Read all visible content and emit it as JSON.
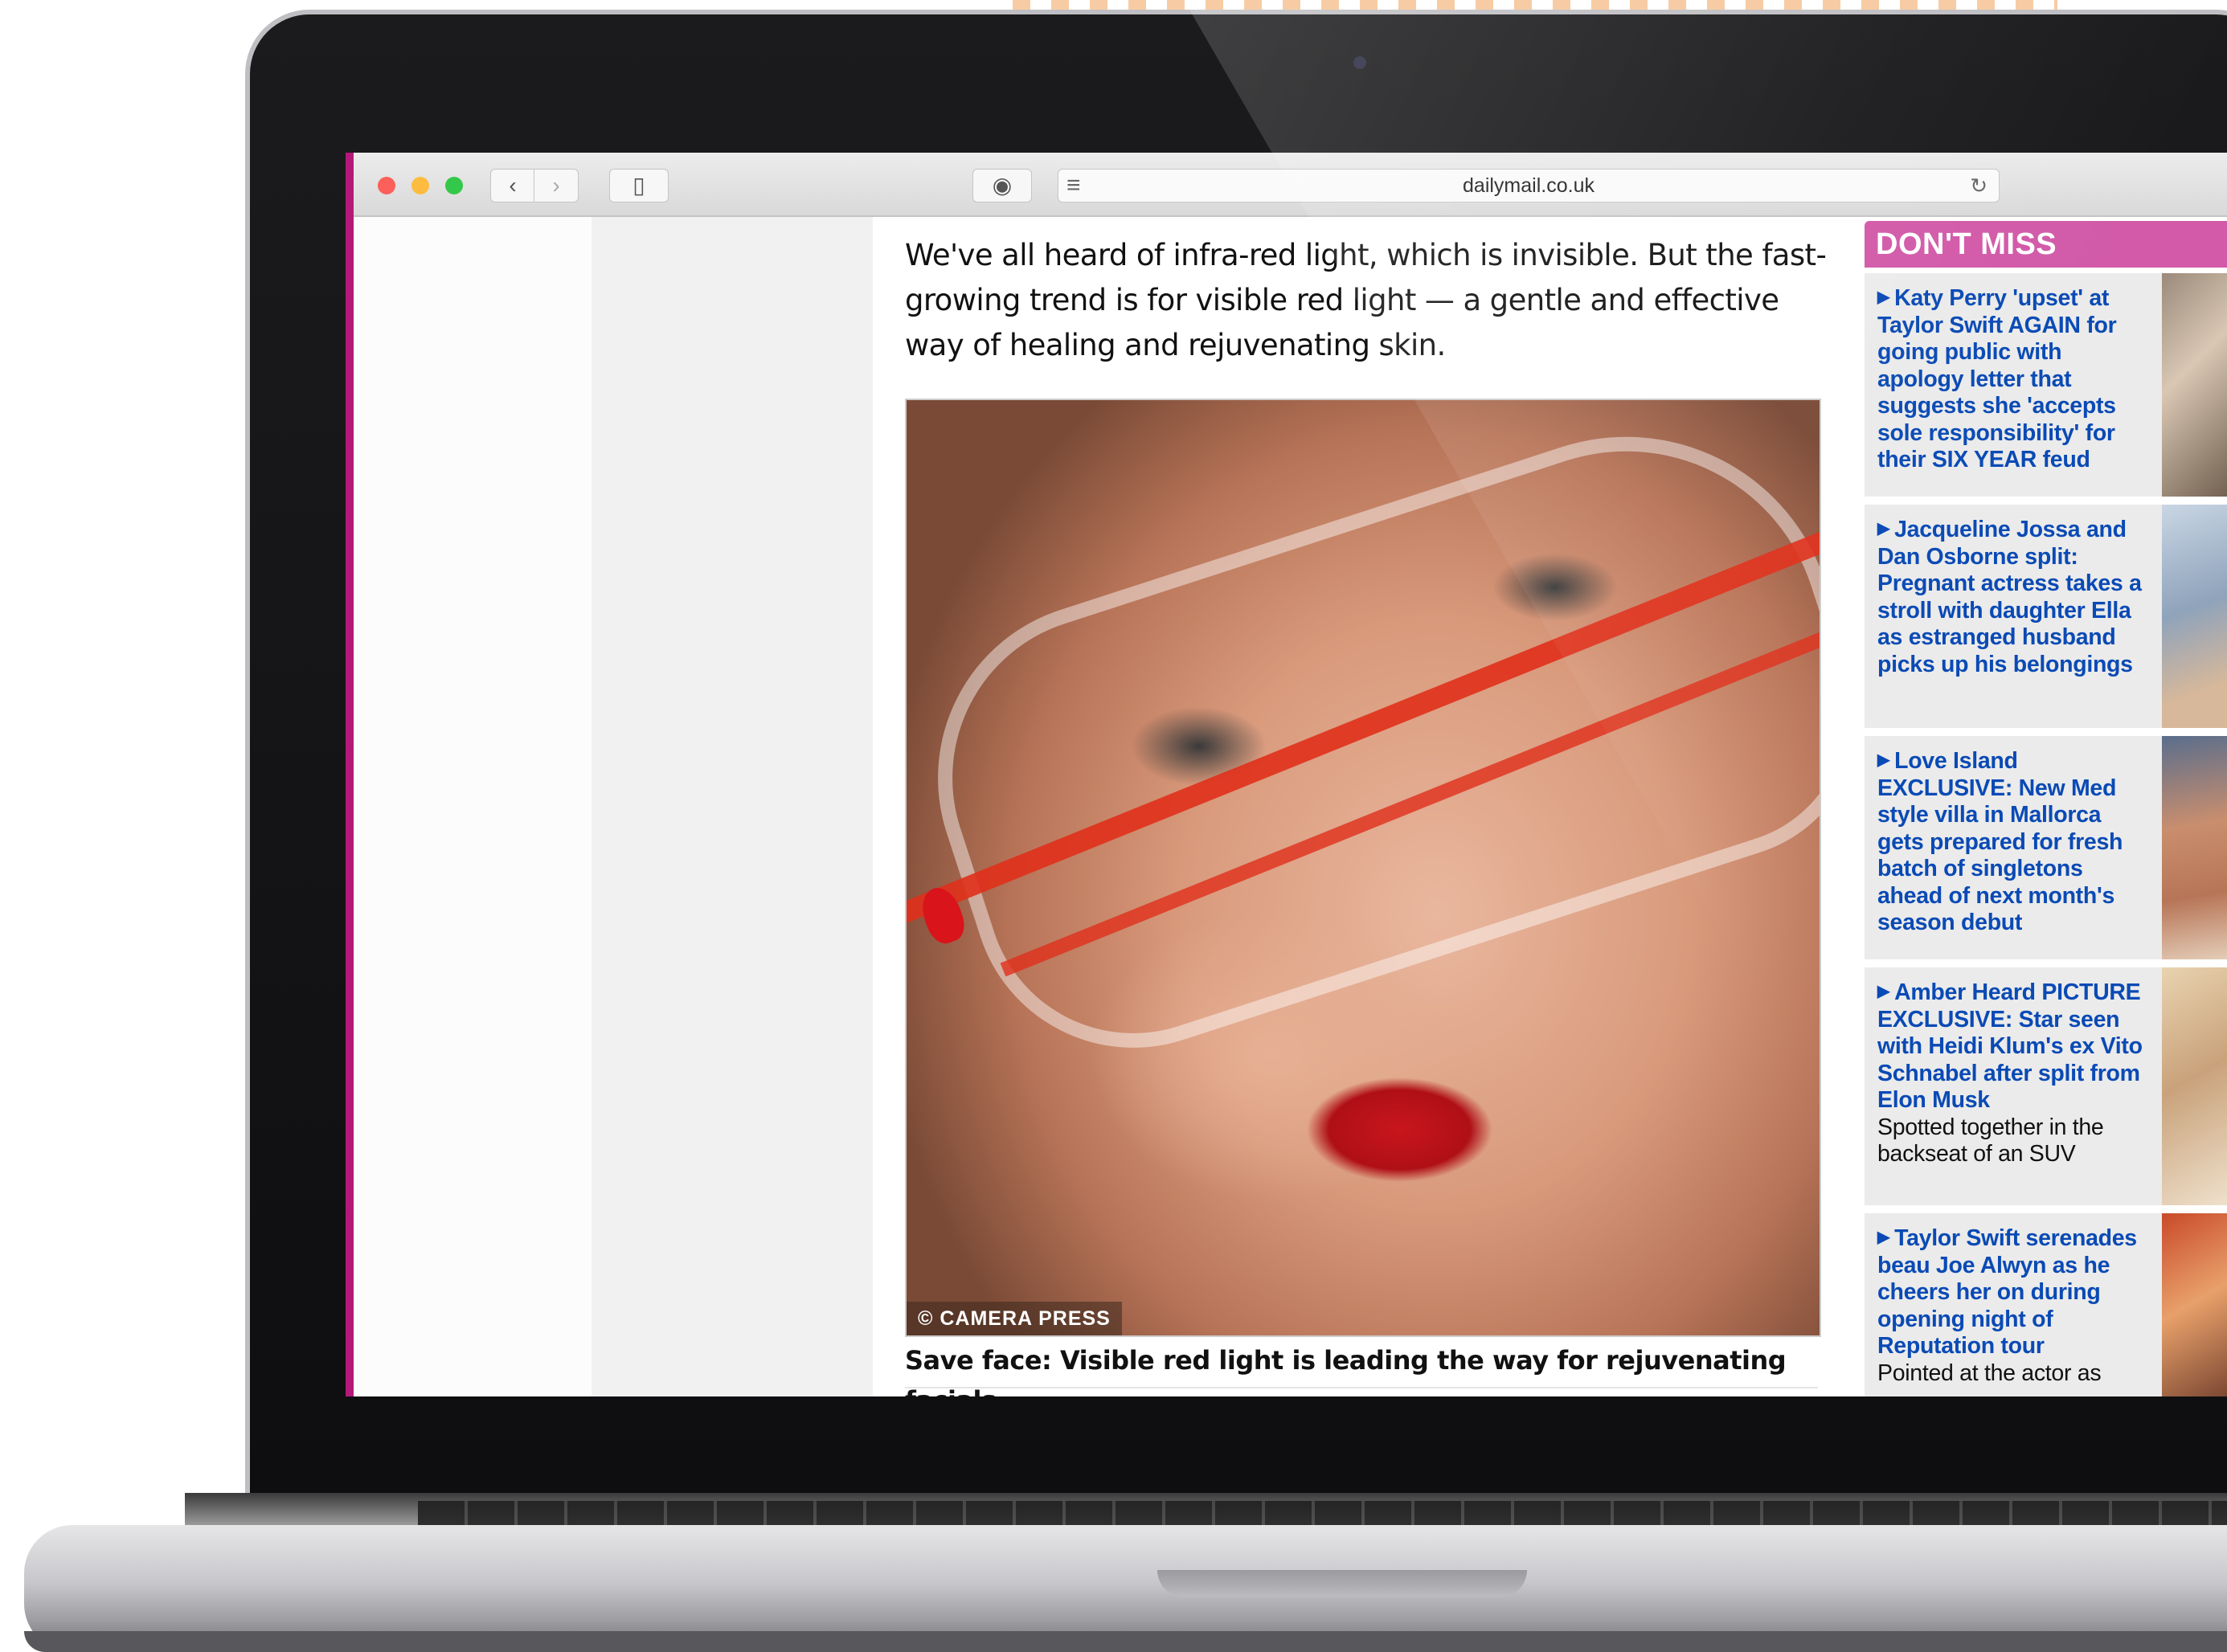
{
  "browser": {
    "url": "dailymail.co.uk",
    "nav_back_icon": "‹",
    "nav_forward_icon": "›",
    "sidebar_icon": "▯",
    "extension_icon": "◉",
    "reader_icon": "≡",
    "reload_icon": "↻"
  },
  "article": {
    "body_text": "We've all heard of infra-red light, which is invisible. But the fast-growing trend is for visible red light — a gentle and effective way of healing and rejuvenating skin.",
    "photo_credit": "© CAMERA PRESS",
    "caption": "Save face: Visible red light is leading the way for rejuvenating facials"
  },
  "dont_miss": {
    "title": "DON'T MISS",
    "items": [
      {
        "headline": "Katy Perry 'upset' at Taylor Swift AGAIN for going public with apology letter that suggests she 'accepts sole responsibility' for their SIX YEAR feud",
        "subtext": ""
      },
      {
        "headline": "Jacqueline Jossa and Dan Osborne split: Pregnant actress takes a stroll with daughter Ella as estranged husband picks up his belongings",
        "subtext": ""
      },
      {
        "headline": "Love Island EXCLUSIVE: New Med style villa in Mallorca gets prepared for fresh batch of singletons ahead of next month's season debut",
        "subtext": ""
      },
      {
        "headline": "Amber Heard PICTURE EXCLUSIVE: Star seen with Heidi Klum's ex Vito Schnabel after split from Elon Musk",
        "subtext": "Spotted together in the backseat of an SUV"
      },
      {
        "headline": "Taylor Swift serenades beau Joe Alwyn as he cheers her on during opening night of Reputation tour",
        "subtext": "Pointed at the actor as"
      }
    ]
  },
  "colors": {
    "accent_magenta": "#d25aa9",
    "link_blue": "#0a4ab5",
    "page_border": "#b4197a"
  }
}
